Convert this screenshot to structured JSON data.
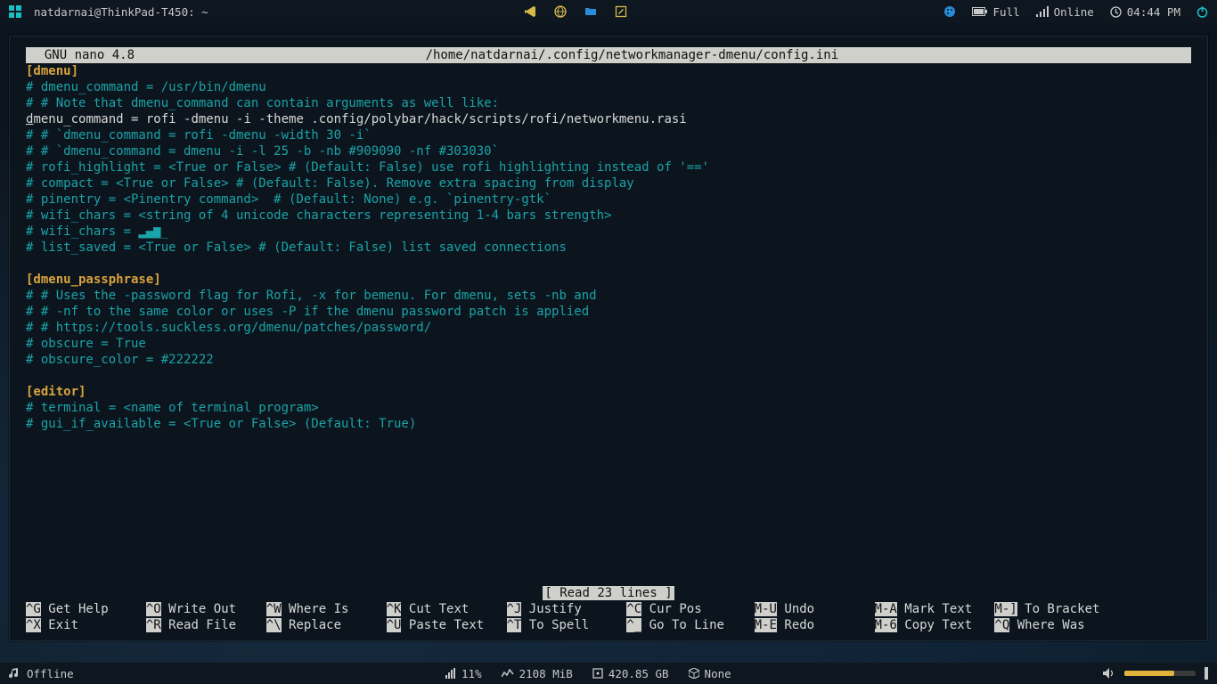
{
  "topbar": {
    "workspace_icon": "grid-icon",
    "title": "natdarnai@ThinkPad-T450: ~",
    "center_icons": [
      "vscode-icon",
      "globe-icon",
      "folder-icon",
      "edit-icon"
    ],
    "battery": "Full",
    "network": "Online",
    "time": "04:44 PM"
  },
  "nano": {
    "app": "  GNU nano 4.8",
    "path": "/home/natdarnai/.config/networkmanager-dmenu/config.ini",
    "status": "[ Read 23 lines ]",
    "lines": [
      {
        "cls": "h",
        "t": "[dmenu]"
      },
      {
        "cls": "c",
        "t": "# dmenu_command = /usr/bin/dmenu"
      },
      {
        "cls": "c",
        "t": "# # Note that dmenu_command can contain arguments as well like:"
      },
      {
        "cls": "",
        "t": "dmenu_command = rofi -dmenu -i -theme .config/polybar/hack/scripts/rofi/networkmenu.rasi"
      },
      {
        "cls": "c",
        "t": "# # `dmenu_command = rofi -dmenu -width 30 -i`"
      },
      {
        "cls": "c",
        "t": "# # `dmenu_command = dmenu -i -l 25 -b -nb #909090 -nf #303030`"
      },
      {
        "cls": "c",
        "t": "# rofi_highlight = <True or False> # (Default: False) use rofi highlighting instead of '=='"
      },
      {
        "cls": "c",
        "t": "# compact = <True or False> # (Default: False). Remove extra spacing from display"
      },
      {
        "cls": "c",
        "t": "# pinentry = <Pinentry command>  # (Default: None) e.g. `pinentry-gtk`"
      },
      {
        "cls": "c",
        "t": "# wifi_chars = <string of 4 unicode characters representing 1-4 bars strength>"
      },
      {
        "cls": "wifi",
        "t": "# wifi_chars = "
      },
      {
        "cls": "c",
        "t": "# list_saved = <True or False> # (Default: False) list saved connections"
      },
      {
        "cls": "",
        "t": ""
      },
      {
        "cls": "h",
        "t": "[dmenu_passphrase]"
      },
      {
        "cls": "c",
        "t": "# # Uses the -password flag for Rofi, -x for bemenu. For dmenu, sets -nb and"
      },
      {
        "cls": "c",
        "t": "# # -nf to the same color or uses -P if the dmenu password patch is applied"
      },
      {
        "cls": "c",
        "t": "# # https://tools.suckless.org/dmenu/patches/password/"
      },
      {
        "cls": "c",
        "t": "# obscure = True"
      },
      {
        "cls": "c",
        "t": "# obscure_color = #222222"
      },
      {
        "cls": "",
        "t": ""
      },
      {
        "cls": "h",
        "t": "[editor]"
      },
      {
        "cls": "c",
        "t": "# terminal = <name of terminal program>"
      },
      {
        "cls": "c",
        "t": "# gui_if_available = <True or False> (Default: True)"
      }
    ],
    "shortcuts": {
      "row1": [
        [
          "^G",
          "Get Help"
        ],
        [
          "^O",
          "Write Out"
        ],
        [
          "^W",
          "Where Is"
        ],
        [
          "^K",
          "Cut Text"
        ],
        [
          "^J",
          "Justify"
        ],
        [
          "^C",
          "Cur Pos"
        ],
        [
          "M-U",
          "Undo"
        ],
        [
          "M-A",
          "Mark Text"
        ],
        [
          "M-]",
          "To Bracket"
        ]
      ],
      "row2": [
        [
          "^X",
          "Exit"
        ],
        [
          "^R",
          "Read File"
        ],
        [
          "^\\",
          "Replace"
        ],
        [
          "^U",
          "Paste Text"
        ],
        [
          "^T",
          "To Spell"
        ],
        [
          "^_",
          "Go To Line"
        ],
        [
          "M-E",
          "Redo"
        ],
        [
          "M-6",
          "Copy Text"
        ],
        [
          "^Q",
          "Where Was"
        ]
      ]
    }
  },
  "bottombar": {
    "music": "Offline",
    "cpu": "11%",
    "mem": "2108 MiB",
    "disk": "420.85 GB",
    "updates": "None"
  }
}
